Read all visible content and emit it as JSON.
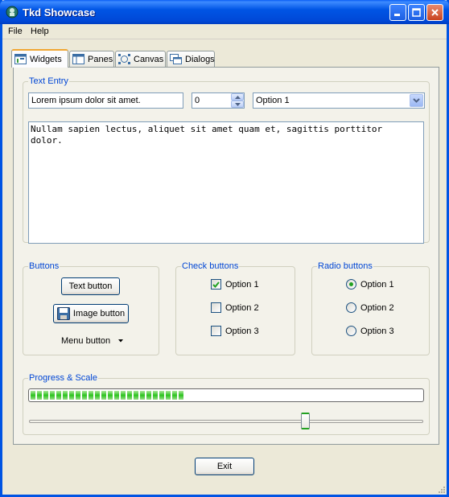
{
  "window": {
    "title": "Tkd Showcase"
  },
  "menu": {
    "items": [
      "File",
      "Help"
    ]
  },
  "tabs": [
    {
      "label": "Widgets",
      "icon": "widgets-icon",
      "active": true
    },
    {
      "label": "Panes",
      "icon": "panes-icon",
      "active": false
    },
    {
      "label": "Canvas",
      "icon": "canvas-icon",
      "active": false
    },
    {
      "label": "Dialogs",
      "icon": "dialogs-icon",
      "active": false
    }
  ],
  "text_entry": {
    "legend": "Text Entry",
    "entry_value": "Lorem ipsum dolor sit amet.",
    "spinbox_value": "0",
    "combo_value": "Option 1",
    "text_area": "Nullam sapien lectus, aliquet sit amet quam et, sagittis porttitor\ndolor."
  },
  "buttons": {
    "legend": "Buttons",
    "text_button": "Text button",
    "image_button": "Image button",
    "menu_button": "Menu button"
  },
  "check_buttons": {
    "legend": "Check buttons",
    "options": [
      {
        "label": "Option 1",
        "checked": true
      },
      {
        "label": "Option 2",
        "checked": false
      },
      {
        "label": "Option 3",
        "checked": false
      }
    ]
  },
  "radio_buttons": {
    "legend": "Radio buttons",
    "options": [
      {
        "label": "Option 1",
        "selected": true
      },
      {
        "label": "Option 2",
        "selected": false
      },
      {
        "label": "Option 3",
        "selected": false
      }
    ]
  },
  "progress_scale": {
    "legend": "Progress & Scale",
    "progress_fraction": 0.4,
    "scale_fraction": 0.7
  },
  "footer": {
    "exit_button": "Exit"
  },
  "colors": {
    "accent": "#0046d5",
    "progress": "#2bc41e",
    "titlebar": "#0055e5"
  }
}
